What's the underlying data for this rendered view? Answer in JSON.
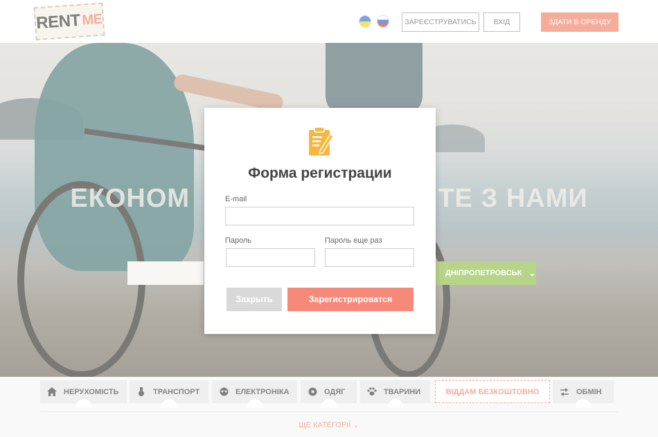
{
  "header": {
    "logo_part1": "RENT",
    "logo_part2": "ME",
    "lang_ua_icon": "ukraine-flag-icon",
    "lang_ru_icon": "russia-flag-icon",
    "register_label": "ЗАРЕЄСТРУВАТИСЬ",
    "login_label": "ВХІД",
    "rent_out_label": "ЗДАТИ В ОРЕНДУ",
    "accent_color": "#ee7b5e"
  },
  "hero": {
    "title": "ЕКОНОМ                               ТЕ З НАМИ",
    "city_label": "ДНІПРОПЕТРОВСЬК",
    "city_color": "#8cbc3f"
  },
  "categories": {
    "items": [
      {
        "label": "НЕРУХОМІСТЬ",
        "icon": "house-icon"
      },
      {
        "label": "ТРАНСПОРТ",
        "icon": "transport-icon"
      },
      {
        "label": "ЕЛЕКТРОНІКА",
        "icon": "electronics-icon"
      },
      {
        "label": "ОДЯГ",
        "icon": "clothes-icon"
      },
      {
        "label": "ТВАРИНИ",
        "icon": "paw-icon"
      },
      {
        "label": "ВІДДАМ БЕЗКОШТОВНО",
        "icon": ""
      },
      {
        "label": "ОБМІН",
        "icon": "exchange-icon"
      }
    ],
    "more_label": "ЩЕ КАТЕГОРІЇ"
  },
  "modal": {
    "icon": "clipboard-pencil-icon",
    "title": "Форма регистрации",
    "email_label": "E-mail",
    "email_value": "",
    "password_label": "Пароль",
    "password_value": "",
    "password_repeat_label": "Пароль еще раз",
    "password_repeat_value": "",
    "close_label": "Закрыть",
    "submit_label": "Зарегистрироватся"
  }
}
